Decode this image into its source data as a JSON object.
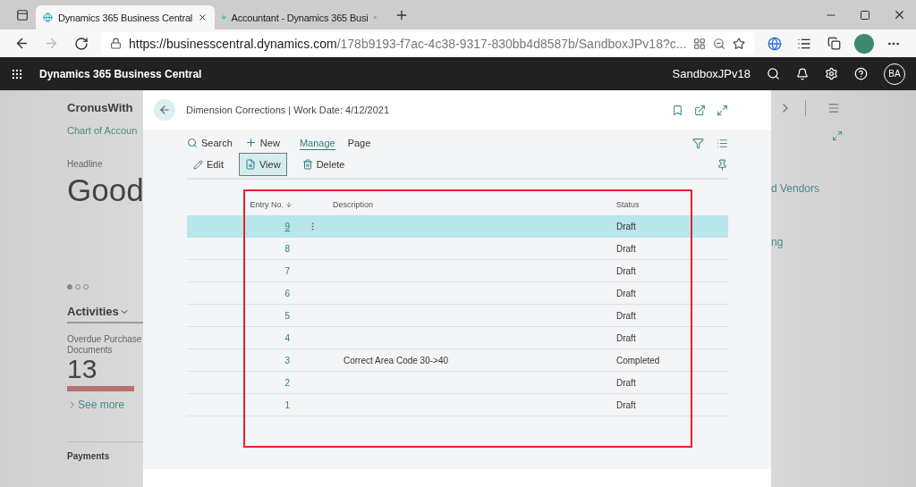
{
  "browser": {
    "tabs": [
      {
        "title": "Dynamics 365 Business Central",
        "selected": true
      },
      {
        "title": "Accountant - Dynamics 365 Busi",
        "selected": false
      }
    ],
    "url_host": "https://businesscentral.dynamics.com",
    "url_path": "/178b9193-f7ac-4c38-9317-830bb4d8587b/SandboxJPv18?c..."
  },
  "app_bar": {
    "title": "Dynamics 365 Business Central",
    "environment": "SandboxJPv18",
    "avatar": "BA"
  },
  "background_page": {
    "company": "CronusWith",
    "link": "Chart of Accoun",
    "headline_label": "Headline",
    "headline": "Good",
    "dots": [
      {
        "selected": true
      },
      {
        "selected": false
      },
      {
        "selected": false
      }
    ],
    "activities": "Activities",
    "tile_label": "Overdue Purchase Documents",
    "tile_value": "13",
    "see_more": "See more",
    "payments": "Payments",
    "right_texts": [
      "d Vendors",
      "ng"
    ]
  },
  "dialog": {
    "title": "Dimension Corrections | Work Date: 4/12/2021",
    "menu": [
      {
        "label": "Search",
        "kind": "search",
        "selected": false
      },
      {
        "label": "New",
        "kind": "new",
        "selected": false
      },
      {
        "label": "Manage",
        "kind": "tab",
        "selected": true
      },
      {
        "label": "Page",
        "kind": "tab",
        "selected": false
      }
    ],
    "actions": [
      {
        "label": "Edit",
        "kind": "edit",
        "selected": false
      },
      {
        "label": "View",
        "kind": "view",
        "selected": true
      },
      {
        "label": "Delete",
        "kind": "delete",
        "selected": false
      }
    ],
    "columns": [
      {
        "label": "Entry No.",
        "sorted_descending": true
      },
      {
        "label": "Description",
        "sorted_descending": false
      },
      {
        "label": "Status",
        "sorted_descending": false
      }
    ],
    "rows": [
      {
        "entry": "9",
        "description": "",
        "status": "Draft",
        "selected": true
      },
      {
        "entry": "8",
        "description": "",
        "status": "Draft",
        "selected": false
      },
      {
        "entry": "7",
        "description": "",
        "status": "Draft",
        "selected": false
      },
      {
        "entry": "6",
        "description": "",
        "status": "Draft",
        "selected": false
      },
      {
        "entry": "5",
        "description": "",
        "status": "Draft",
        "selected": false
      },
      {
        "entry": "4",
        "description": "",
        "status": "Draft",
        "selected": false
      },
      {
        "entry": "3",
        "description": "Correct Area Code 30->40",
        "status": "Completed",
        "selected": false
      },
      {
        "entry": "2",
        "description": "",
        "status": "Draft",
        "selected": false
      },
      {
        "entry": "1",
        "description": "",
        "status": "Draft",
        "selected": false
      }
    ]
  }
}
